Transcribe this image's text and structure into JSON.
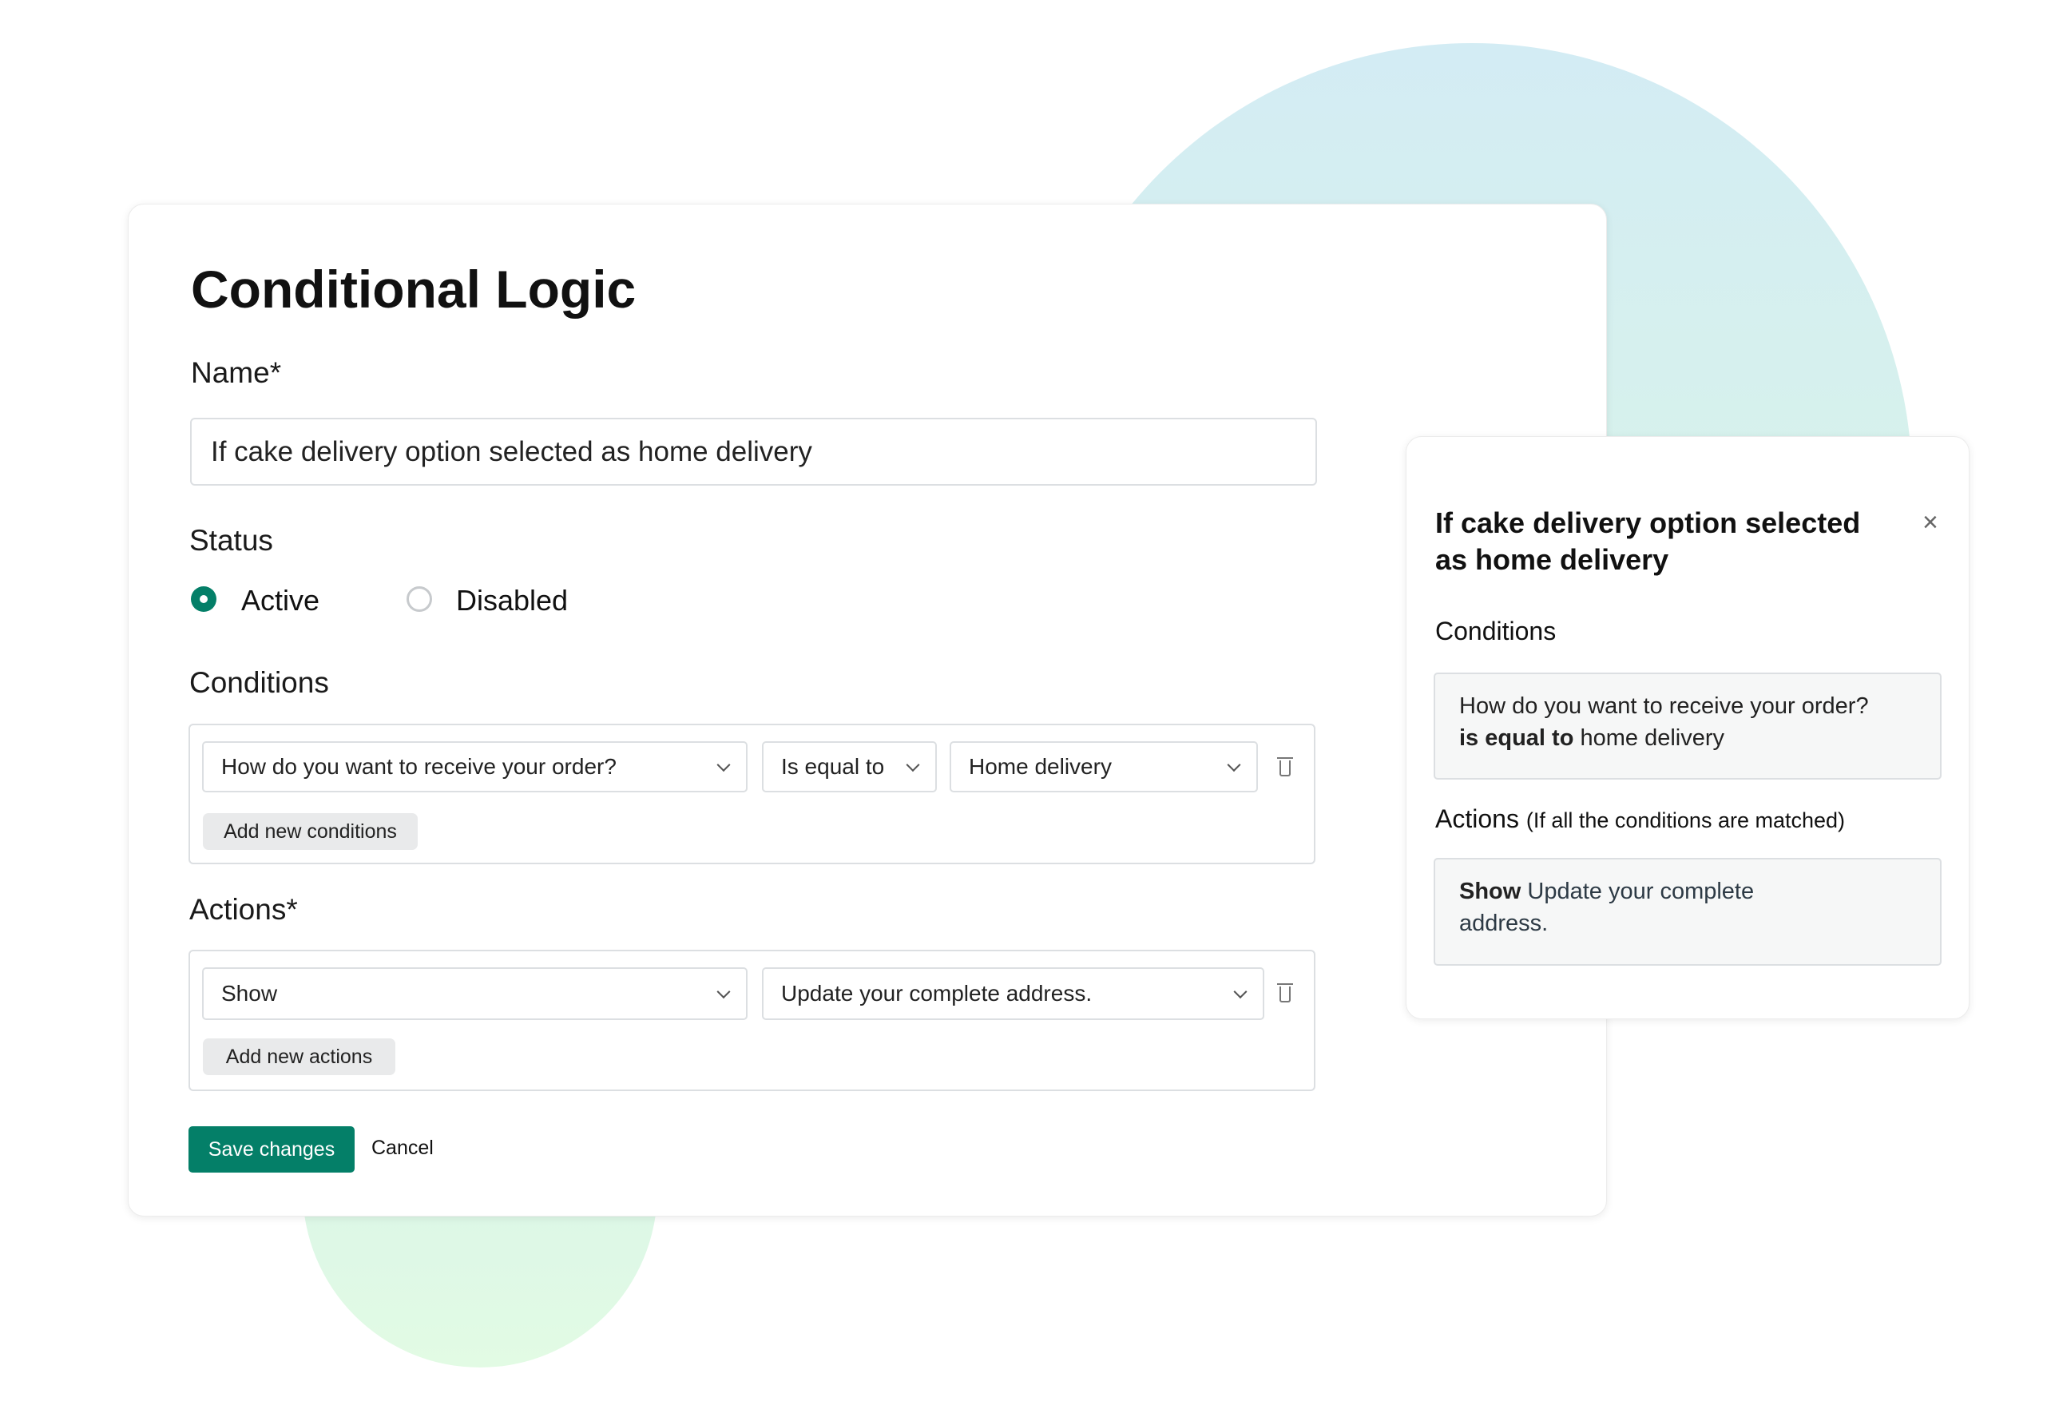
{
  "colors": {
    "accent": "#047f68",
    "bg_circle": "#d3ecf4"
  },
  "editor": {
    "title": "Conditional Logic",
    "name_label": "Name*",
    "name_value": "If cake delivery option selected as home delivery",
    "status_label": "Status",
    "status_options": [
      {
        "label": "Active",
        "selected": true
      },
      {
        "label": "Disabled",
        "selected": false
      }
    ],
    "conditions_label": "Conditions",
    "condition": {
      "field": "How do you want to receive your order?",
      "operator": "Is equal to",
      "value": "Home delivery"
    },
    "add_condition": "Add new conditions",
    "actions_label": "Actions*",
    "action": {
      "type": "Show",
      "target": "Update your complete address."
    },
    "add_action": "Add new actions",
    "save": "Save changes",
    "cancel": "Cancel"
  },
  "summary": {
    "title": "If cake delivery option selected as home delivery",
    "conditions_label": "Conditions",
    "condition_field": "How do you want to receive your order?",
    "condition_operator": "is equal to",
    "condition_value": "home delivery",
    "actions_label": "Actions",
    "actions_note": "(If all the conditions are matched)",
    "action_type": "Show",
    "action_target": "Update your complete address."
  }
}
